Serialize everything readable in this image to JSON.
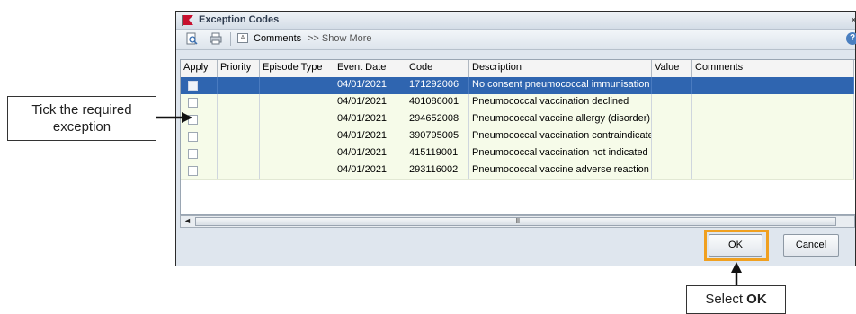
{
  "window": {
    "title": "Exception Codes",
    "close_glyph": "×"
  },
  "toolbar": {
    "comments_label": "Comments",
    "show_more_label": ">> Show More",
    "help_glyph": "?"
  },
  "grid": {
    "columns": [
      "Apply",
      "Priority",
      "Episode Type",
      "Event Date",
      "Code",
      "Description",
      "Value",
      "Comments"
    ],
    "rows": [
      {
        "apply": false,
        "priority": "",
        "episode_type": "",
        "event_date": "04/01/2021",
        "code": "171292006",
        "description": "No consent pneumococcal immunisation",
        "value": "",
        "comments": "",
        "selected": true
      },
      {
        "apply": false,
        "priority": "",
        "episode_type": "",
        "event_date": "04/01/2021",
        "code": "401086001",
        "description": "Pneumococcal vaccination declined",
        "value": "",
        "comments": ""
      },
      {
        "apply": false,
        "priority": "",
        "episode_type": "",
        "event_date": "04/01/2021",
        "code": "294652008",
        "description": "Pneumococcal vaccine allergy (disorder)",
        "value": "",
        "comments": ""
      },
      {
        "apply": false,
        "priority": "",
        "episode_type": "",
        "event_date": "04/01/2021",
        "code": "390795005",
        "description": "Pneumococcal vaccination contraindicated",
        "value": "",
        "comments": ""
      },
      {
        "apply": false,
        "priority": "",
        "episode_type": "",
        "event_date": "04/01/2021",
        "code": "415119001",
        "description": "Pneumococcal vaccination not indicated",
        "value": "",
        "comments": ""
      },
      {
        "apply": false,
        "priority": "",
        "episode_type": "",
        "event_date": "04/01/2021",
        "code": "293116002",
        "description": "Pneumococcal vaccine adverse reaction",
        "value": "",
        "comments": ""
      }
    ]
  },
  "scrollbar": {
    "grip": "III",
    "left_arrow": "◄"
  },
  "buttons": {
    "ok_label": "OK",
    "cancel_label": "Cancel"
  },
  "callouts": {
    "tick_line1": "Tick the required",
    "tick_line2": "exception",
    "select_prefix": "Select ",
    "select_bold": "OK"
  },
  "colors": {
    "selected_row": "#2f65b0",
    "row_background": "#f6fbe9",
    "highlight_border": "#f0a020"
  }
}
